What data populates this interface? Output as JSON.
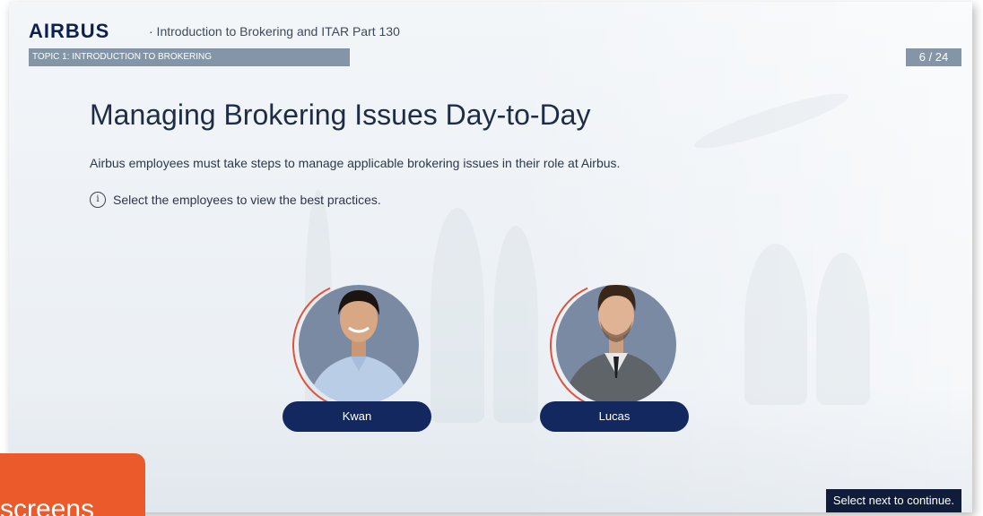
{
  "header": {
    "logo": "AIRBUS",
    "course_title": "· Introduction to Brokering and ITAR Part 130",
    "topic": "TOPIC 1: INTRODUCTION TO BROKERING",
    "page_counter": "6 / 24"
  },
  "content": {
    "heading": "Managing Brokering Issues Day-to-Day",
    "subtitle": "Airbus employees must take steps to manage applicable brokering issues in their role at Airbus.",
    "instruction": "Select the employees to view the best practices.",
    "info_icon": "info-icon"
  },
  "employees": [
    {
      "name": "Kwan",
      "shirt_color": "#b9cde6",
      "hair_color": "#1b1410",
      "skin_color": "#d8a884"
    },
    {
      "name": "Lucas",
      "shirt_color": "#5e6468",
      "hair_color": "#3a2718",
      "skin_color": "#e0b394"
    }
  ],
  "footer": {
    "next_message": "Select next to continue."
  },
  "overlay": {
    "label": "screens"
  },
  "colors": {
    "accent_orange": "#ea5a2a",
    "navy": "#13285e",
    "topic_bar": "#8595a8",
    "arc": "#e0533a"
  }
}
